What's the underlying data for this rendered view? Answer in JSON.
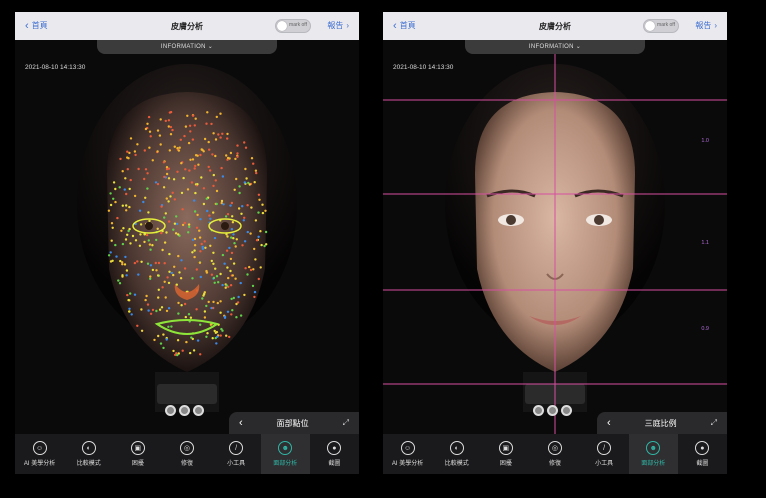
{
  "screens": [
    {
      "back_label": "首頁",
      "title": "皮膚分析",
      "toggle_label": "mark off",
      "report_label": "報告",
      "info_label": "INFORMATION ⌄",
      "timestamp": "2021-08-10 14:13:30",
      "panel_title": "面部點位",
      "tabs": [
        {
          "label": "AI 美學分析",
          "icon": "ai-face-icon"
        },
        {
          "label": "比較模式",
          "icon": "compare-icon"
        },
        {
          "label": "困擾",
          "icon": "concern-icon"
        },
        {
          "label": "修復",
          "icon": "repair-icon"
        },
        {
          "label": "小工具",
          "icon": "tool-icon"
        },
        {
          "label": "面部分析",
          "icon": "face-analysis-icon",
          "active": true
        },
        {
          "label": "截圖",
          "icon": "screenshot-icon"
        }
      ]
    },
    {
      "back_label": "首頁",
      "title": "皮膚分析",
      "toggle_label": "mark off",
      "report_label": "報告",
      "info_label": "INFORMATION ⌄",
      "timestamp": "2021-08-10 14:13:30",
      "panel_title": "三庭比例",
      "ratios": [
        "1.0",
        "1.1",
        "0.9"
      ],
      "tabs": [
        {
          "label": "AI 美學分析",
          "icon": "ai-face-icon"
        },
        {
          "label": "比較模式",
          "icon": "compare-icon"
        },
        {
          "label": "困擾",
          "icon": "concern-icon"
        },
        {
          "label": "修復",
          "icon": "repair-icon"
        },
        {
          "label": "小工具",
          "icon": "tool-icon"
        },
        {
          "label": "面部分析",
          "icon": "face-analysis-icon",
          "active": true
        },
        {
          "label": "截圖",
          "icon": "screenshot-icon"
        }
      ]
    }
  ]
}
